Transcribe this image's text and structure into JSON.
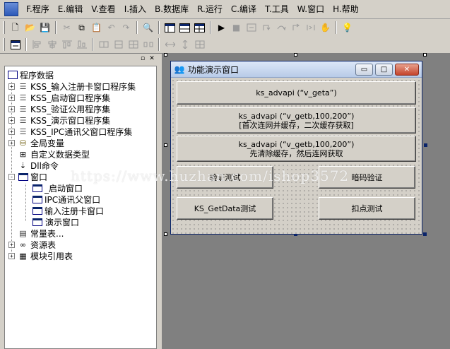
{
  "menu": [
    {
      "label": "F.程序"
    },
    {
      "label": "E.编辑"
    },
    {
      "label": "V.查看"
    },
    {
      "label": "I.插入"
    },
    {
      "label": "B.数据库"
    },
    {
      "label": "R.运行"
    },
    {
      "label": "C.编译"
    },
    {
      "label": "T.工具"
    },
    {
      "label": "W.窗口"
    },
    {
      "label": "H.帮助"
    }
  ],
  "toolbar": {
    "glyph_new": "🗋",
    "glyph_open": "📂",
    "glyph_save": "💾",
    "glyph_cut": "✂",
    "glyph_copy": "⧉",
    "glyph_paste": "📋",
    "glyph_undo": "↶",
    "glyph_redo": "↷",
    "glyph_find": "🔍",
    "glyph_run": "▶",
    "glyph_stop": "■",
    "glyph_hand": "✋",
    "glyph_bulb": "💡"
  },
  "tree": {
    "root_label": "程序数据",
    "items": [
      {
        "label": "KSS_输入注册卡窗口程序集",
        "toggle": "+"
      },
      {
        "label": "KSS_启动窗口程序集",
        "toggle": "+"
      },
      {
        "label": "KSS_验证公用程序集",
        "toggle": "+"
      },
      {
        "label": "KSS_演示窗口程序集",
        "toggle": "+"
      },
      {
        "label": "KSS_IPC通讯父窗口程序集",
        "toggle": "+"
      },
      {
        "label": "全局变量",
        "toggle": "+"
      },
      {
        "label": "自定义数据类型",
        "toggle": ""
      },
      {
        "label": "Dll命令",
        "toggle": ""
      },
      {
        "label": "窗口",
        "toggle": "-"
      },
      {
        "label": "_启动窗口",
        "toggle": ""
      },
      {
        "label": "IPC通讯父窗口",
        "toggle": ""
      },
      {
        "label": "输入注册卡窗口",
        "toggle": ""
      },
      {
        "label": "演示窗口",
        "toggle": ""
      },
      {
        "label": "常量表...",
        "toggle": ""
      },
      {
        "label": "资源表",
        "toggle": "+"
      },
      {
        "label": "模块引用表",
        "toggle": "+"
      }
    ]
  },
  "form": {
    "title": "功能演示窗口",
    "btn_minimize": "▭",
    "btn_maximize": "□",
    "btn_close": "✕",
    "buttons": [
      {
        "lines": [
          "ks_advapi (“v_geta”)"
        ]
      },
      {
        "lines": [
          "ks_advapi (“v_getb,100,200”)",
          "[首次连网并缓存，二次缓存获取]"
        ]
      },
      {
        "lines": [
          "ks_advapi (“v_getb,100,200”)",
          "先清除缓存，然后连网获取"
        ]
      },
      {
        "lines": [
          "验证测试"
        ]
      },
      {
        "lines": [
          "暗码验证"
        ]
      },
      {
        "lines": [
          "KS_GetData测试"
        ]
      },
      {
        "lines": [
          "扣点测试"
        ]
      }
    ]
  },
  "watermark": "https://www.huzhan.com/ishop3572"
}
